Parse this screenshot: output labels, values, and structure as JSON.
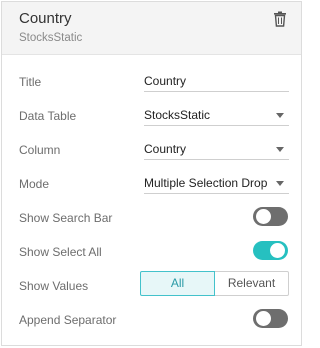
{
  "header": {
    "title": "Country",
    "subtitle": "StocksStatic",
    "icon": "trash-icon"
  },
  "fields": {
    "title": {
      "label": "Title",
      "value": "Country"
    },
    "data_table": {
      "label": "Data Table",
      "value": "StocksStatic"
    },
    "column": {
      "label": "Column",
      "value": "Country"
    },
    "mode": {
      "label": "Mode",
      "value": "Multiple Selection Drop"
    }
  },
  "toggles": {
    "show_search_bar": {
      "label": "Show Search Bar",
      "on": false
    },
    "show_select_all": {
      "label": "Show Select All",
      "on": true
    },
    "append_separator": {
      "label": "Append Separator",
      "on": false
    }
  },
  "show_values": {
    "label": "Show Values",
    "options": [
      "All",
      "Relevant"
    ],
    "selected": "All"
  },
  "colors": {
    "accent": "#26c0c0",
    "toggle_off": "#6e6e6e",
    "header_bg": "#f4f4f4"
  }
}
